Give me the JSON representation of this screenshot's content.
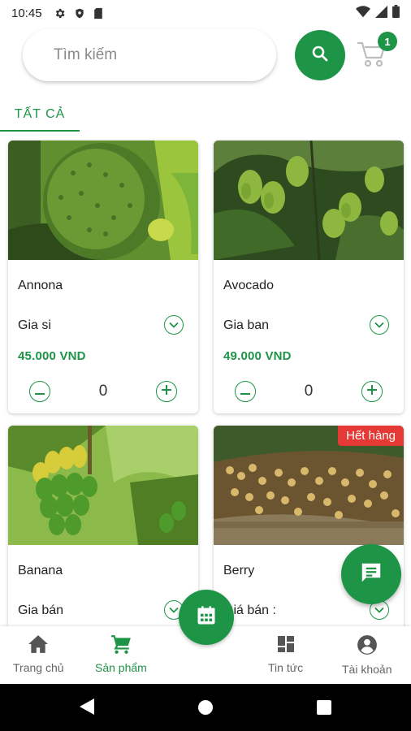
{
  "status_bar": {
    "time": "10:45"
  },
  "search": {
    "placeholder": "Tìm kiếm"
  },
  "cart": {
    "badge_count": "1"
  },
  "tabs": [
    {
      "label": "TẤT CẢ",
      "active": true
    }
  ],
  "products": [
    {
      "name": "Annona",
      "price_type": "Gia si",
      "price": "45.000 VND",
      "quantity": "0",
      "sold_out": false
    },
    {
      "name": "Avocado",
      "price_type": "Gia ban",
      "price": "49.000 VND",
      "quantity": "0",
      "sold_out": false
    },
    {
      "name": "Banana",
      "price_type": "Gia bán",
      "price": "",
      "quantity": "",
      "sold_out": false
    },
    {
      "name": "Berry",
      "price_type": "Giá bán :",
      "price": "",
      "quantity": "",
      "sold_out": true,
      "sold_out_label": "Hết hàng"
    }
  ],
  "bottom_nav": {
    "items": [
      {
        "label": "Trang chủ",
        "icon": "home-icon",
        "active": false
      },
      {
        "label": "Sản phẩm",
        "icon": "cart-icon",
        "active": true
      },
      {
        "label": "Tin tức",
        "icon": "dashboard-icon",
        "active": false
      },
      {
        "label": "Tài khoản",
        "icon": "account-circle-icon",
        "active": false
      }
    ]
  },
  "colors": {
    "accent": "#1e9447",
    "sold_out": "#e53935"
  }
}
